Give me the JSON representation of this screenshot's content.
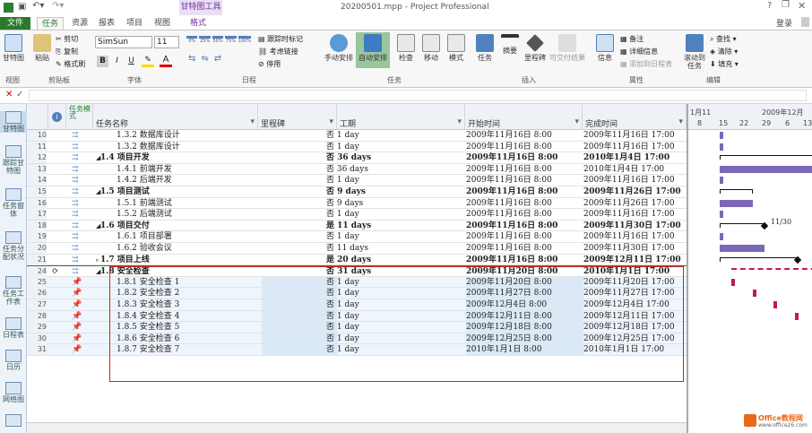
{
  "window": {
    "title": "20200501.mpp - Project Professional",
    "contextual_tab": "甘特图工具",
    "help": "?",
    "login": "登录"
  },
  "tabs": [
    "文件",
    "任务",
    "资源",
    "报表",
    "项目",
    "视图",
    "格式"
  ],
  "ribbon": {
    "view_btn": "甘特图",
    "paste": "粘贴",
    "cut": "剪切",
    "copy": "复制",
    "format_painter": "格式刷",
    "font_name": "SimSun",
    "font_size": "11",
    "bold": "B",
    "italic": "I",
    "underline": "U",
    "pct": [
      "0%",
      "25%",
      "50%",
      "75%",
      "100%"
    ],
    "track": "跟踪时标记",
    "respect_links": "考虑链接",
    "inactivate": "停用",
    "manual": "手动安排",
    "auto": "自动安排",
    "inspect": "检查",
    "move": "移动",
    "mode": "模式",
    "task": "任务",
    "summary": "摘要",
    "milestone": "里程碑",
    "deliverable": "可交付结果",
    "info": "信息",
    "notes": "备注",
    "details": "详细信息",
    "add_timeline": "添加到日程表",
    "scroll": "滚动到任务",
    "find": "查找",
    "clear": "清除",
    "fill": "填充",
    "groups": [
      "视图",
      "剪贴板",
      "字体",
      "日程",
      "任务",
      "插入",
      "属性",
      "编辑"
    ]
  },
  "sidebar": [
    "甘特图",
    "跟踪甘特图",
    "任务窗体",
    "任务分配状况",
    "任务工作表",
    "日程表",
    "日历",
    "网络图"
  ],
  "columns": [
    "任务名称",
    "里程碑",
    "工期",
    "开始时间",
    "完成时间"
  ],
  "col_mode": "任务模式",
  "rows": [
    {
      "id": "10",
      "name": "1.3.2 数据库设计",
      "ms": "",
      "dur": "否 1 day",
      "start": "2009年11月16日 8:00",
      "end": "2009年11月16日 17:00",
      "lvl": 3,
      "bold": false,
      "pin": false
    },
    {
      "id": "11",
      "name": "1.3.2 数据库设计",
      "ms": "",
      "dur": "否 1 day",
      "start": "2009年11月16日 8:00",
      "end": "2009年11月16日 17:00",
      "lvl": 3,
      "bold": false,
      "pin": false
    },
    {
      "id": "12",
      "name": "1.4 项目开发",
      "ms": "",
      "dur": "否 36 days",
      "start": "2009年11月16日 8:00",
      "end": "2010年1月4日 17:00",
      "lvl": 2,
      "bold": true,
      "pin": false
    },
    {
      "id": "13",
      "name": "1.4.1 前端开发",
      "ms": "",
      "dur": "否 36 days",
      "start": "2009年11月16日 8:00",
      "end": "2010年1月4日 17:00",
      "lvl": 3,
      "bold": false,
      "pin": false
    },
    {
      "id": "14",
      "name": "1.4.2 后端开发",
      "ms": "",
      "dur": "否 1 day",
      "start": "2009年11月16日 8:00",
      "end": "2009年11月16日 17:00",
      "lvl": 3,
      "bold": false,
      "pin": false
    },
    {
      "id": "15",
      "name": "1.5 项目测试",
      "ms": "",
      "dur": "否 9 days",
      "start": "2009年11月16日 8:00",
      "end": "2009年11月26日 17:00",
      "lvl": 2,
      "bold": true,
      "pin": false
    },
    {
      "id": "16",
      "name": "1.5.1 前端测试",
      "ms": "",
      "dur": "否 9 days",
      "start": "2009年11月16日 8:00",
      "end": "2009年11月26日 17:00",
      "lvl": 3,
      "bold": false,
      "pin": false
    },
    {
      "id": "17",
      "name": "1.5.2 后端测试",
      "ms": "",
      "dur": "否 1 day",
      "start": "2009年11月16日 8:00",
      "end": "2009年11月16日 17:00",
      "lvl": 3,
      "bold": false,
      "pin": false
    },
    {
      "id": "18",
      "name": "1.6 项目交付",
      "ms": "",
      "dur": "是 11 days",
      "start": "2009年11月16日 8:00",
      "end": "2009年11月30日 17:00",
      "lvl": 2,
      "bold": true,
      "pin": false
    },
    {
      "id": "19",
      "name": "1.6.1 项目部署",
      "ms": "",
      "dur": "否 1 day",
      "start": "2009年11月16日 8:00",
      "end": "2009年11月16日 17:00",
      "lvl": 3,
      "bold": false,
      "pin": false
    },
    {
      "id": "20",
      "name": "1.6.2 验收会议",
      "ms": "",
      "dur": "否 11 days",
      "start": "2009年11月16日 8:00",
      "end": "2009年11月30日 17:00",
      "lvl": 3,
      "bold": false,
      "pin": false
    },
    {
      "id": "21",
      "name": "1.7 项目上线",
      "ms": "",
      "dur": "是 20 days",
      "start": "2009年11月16日 8:00",
      "end": "2009年12月11日 17:00",
      "lvl": 2,
      "bold": true,
      "pin": false
    },
    {
      "id": "24",
      "name": "1.8 安全检查",
      "ms": "",
      "dur": "否 31 days",
      "start": "2009年11月20日 8:00",
      "end": "2010年1月1日 17:00",
      "lvl": 2,
      "bold": true,
      "pin": false
    },
    {
      "id": "25",
      "name": "1.8.1 安全检查 1",
      "ms": "",
      "dur": "否 1 day",
      "start": "2009年11月20日 8:00",
      "end": "2009年11月20日 17:00",
      "lvl": 3,
      "bold": false,
      "pin": true
    },
    {
      "id": "26",
      "name": "1.8.2 安全检查 2",
      "ms": "",
      "dur": "否 1 day",
      "start": "2009年11月27日 8:00",
      "end": "2009年11月27日 17:00",
      "lvl": 3,
      "bold": false,
      "pin": true
    },
    {
      "id": "27",
      "name": "1.8.3 安全检查 3",
      "ms": "",
      "dur": "否 1 day",
      "start": "2009年12月4日 8:00",
      "end": "2009年12月4日 17:00",
      "lvl": 3,
      "bold": false,
      "pin": true
    },
    {
      "id": "28",
      "name": "1.8.4 安全检查 4",
      "ms": "",
      "dur": "否 1 day",
      "start": "2009年12月11日 8:00",
      "end": "2009年12月11日 17:00",
      "lvl": 3,
      "bold": false,
      "pin": true
    },
    {
      "id": "29",
      "name": "1.8.5 安全检查 5",
      "ms": "",
      "dur": "否 1 day",
      "start": "2009年12月18日 8:00",
      "end": "2009年12月18日 17:00",
      "lvl": 3,
      "bold": false,
      "pin": true
    },
    {
      "id": "30",
      "name": "1.8.6 安全检查 6",
      "ms": "",
      "dur": "否 1 day",
      "start": "2009年12月25日 8:00",
      "end": "2009年12月25日 17:00",
      "lvl": 3,
      "bold": false,
      "pin": true
    },
    {
      "id": "31",
      "name": "1.8.7 安全检查 7",
      "ms": "",
      "dur": "否 1 day",
      "start": "2010年1月1日 8:00",
      "end": "2010年1月1日 17:00",
      "lvl": 3,
      "bold": false,
      "pin": true
    }
  ],
  "gantt": {
    "months": [
      "1月11",
      "2009年12月"
    ],
    "days": [
      "8",
      "15",
      "22",
      "29",
      "6",
      "13"
    ],
    "milestone_label": "11/30"
  },
  "watermark": {
    "text": "Office教程网",
    "sub": "www.office26.com"
  },
  "colors": {
    "accent": "#2e7d32",
    "file_tab": "#2a7a2a",
    "bar": "#7b68b6",
    "red_box": "#d62020",
    "pink": "#c2185b",
    "ctx": "#7030a0"
  }
}
